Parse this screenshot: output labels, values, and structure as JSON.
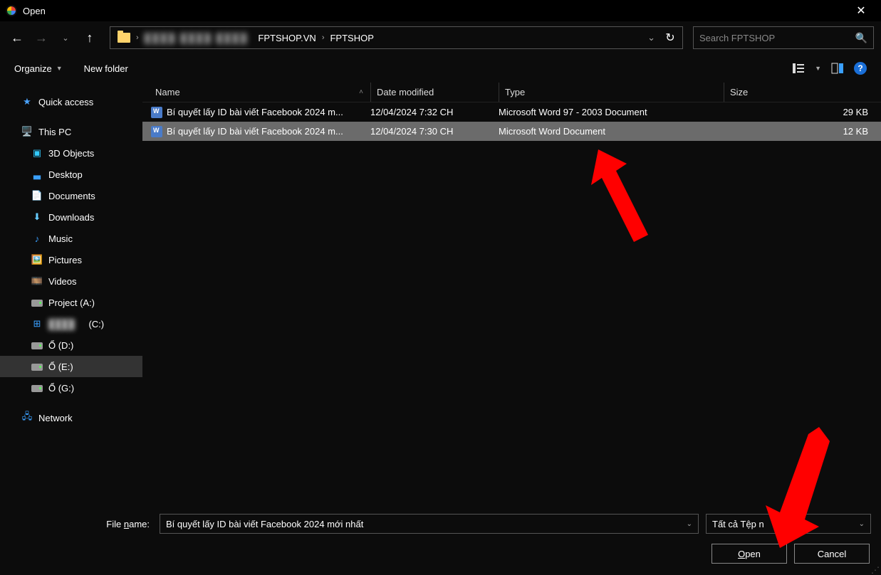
{
  "titlebar": {
    "title": "Open"
  },
  "nav": {
    "breadcrumb": {
      "blur_part": "████   ████   ████",
      "seg1": "FPTSHOP.VN",
      "seg2": "FPTSHOP"
    },
    "search_placeholder": "Search FPTSHOP"
  },
  "toolbar": {
    "organize": "Organize",
    "new_folder": "New folder"
  },
  "sidebar": {
    "quick_access": "Quick access",
    "this_pc": "This PC",
    "children": [
      "3D Objects",
      "Desktop",
      "Documents",
      "Downloads",
      "Music",
      "Pictures",
      "Videos",
      "Project (A:)",
      "",
      "Ổ (D:)",
      "Ổ (E:)",
      "Ổ (G:)"
    ],
    "blur_drive_suffix": "(C:)",
    "network": "Network"
  },
  "columns": {
    "name": "Name",
    "date": "Date modified",
    "type": "Type",
    "size": "Size"
  },
  "files": [
    {
      "name": "Bí quyết lấy ID bài viết Facebook 2024 m...",
      "date": "12/04/2024 7:32 CH",
      "type": "Microsoft Word 97 - 2003 Document",
      "size": "29 KB"
    },
    {
      "name": "Bí quyết lấy ID bài viết Facebook 2024 m...",
      "date": "12/04/2024 7:30 CH",
      "type": "Microsoft Word Document",
      "size": "12 KB"
    }
  ],
  "footer": {
    "file_name_label_pre": "File ",
    "file_name_label_u": "n",
    "file_name_label_post": "ame:",
    "file_name_value": "Bí quyết lấy ID bài viết Facebook 2024 mới nhất",
    "filter": "Tất cả Tệp   n",
    "open_u": "O",
    "open_rest": "pen",
    "cancel": "Cancel"
  }
}
